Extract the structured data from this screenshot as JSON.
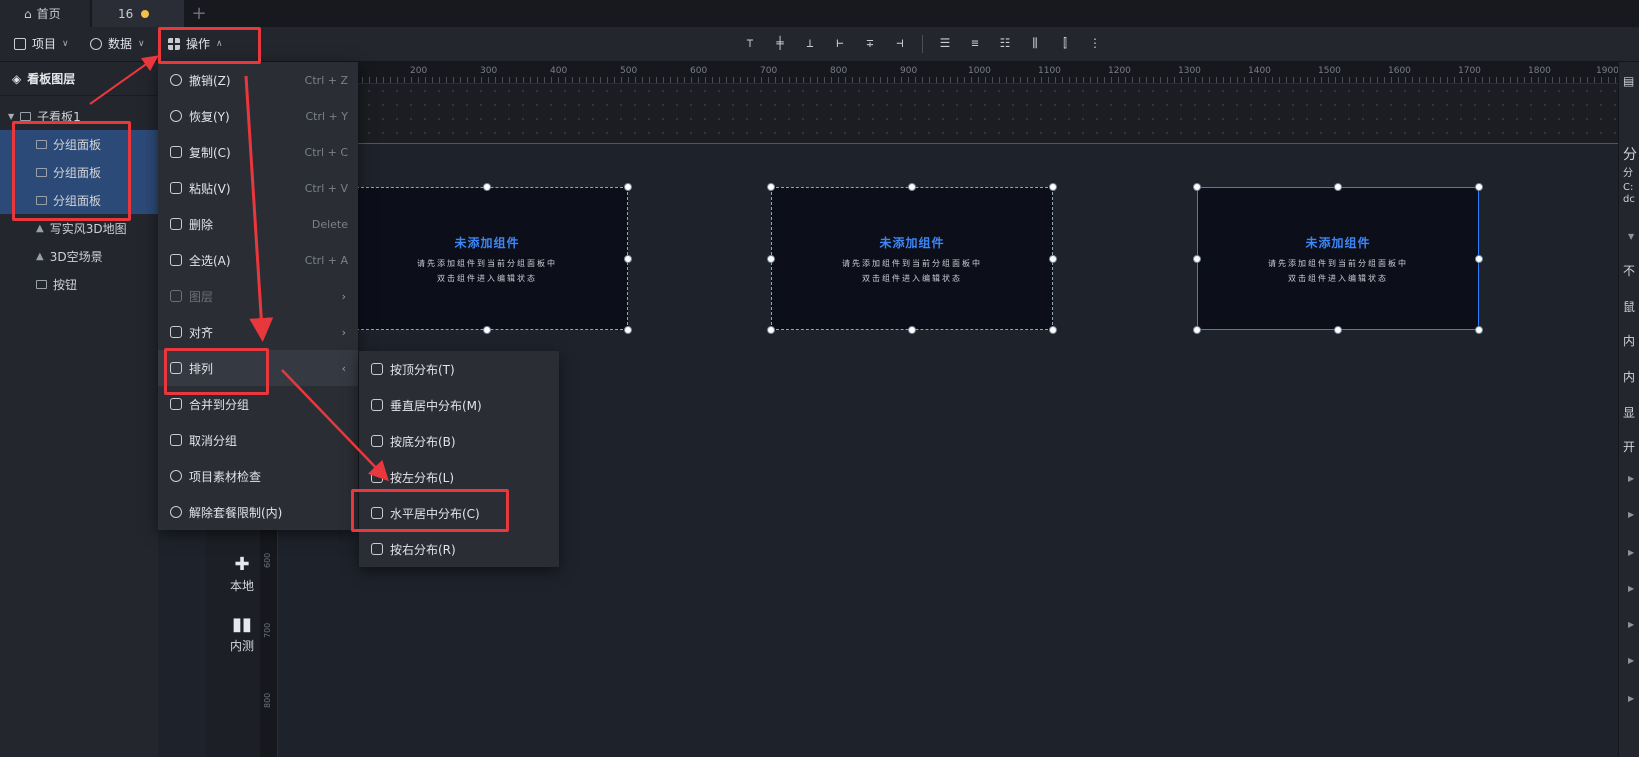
{
  "tabs": {
    "home": "首页",
    "doc": "16",
    "add": "+"
  },
  "toolbar": {
    "project": "项目",
    "data": "数据",
    "operate": "操作"
  },
  "align_tools": [
    "⊤",
    "╪",
    "⊥",
    "⊢",
    "∓",
    "⊣",
    "☰",
    "≡",
    "☷",
    "⫼",
    "⫿",
    "⋮"
  ],
  "layers": {
    "header": "看板图层",
    "root": "子看板1",
    "items": [
      "分组面板",
      "分组面板",
      "分组面板",
      "写实风3D地图",
      "3D空场景",
      "按钮"
    ]
  },
  "nav": {
    "local": "本地",
    "beta": "内测"
  },
  "ruler": {
    "h": [
      "200",
      "300",
      "400",
      "500",
      "600",
      "700",
      "800",
      "900",
      "1000",
      "1100",
      "1200",
      "1300",
      "1400",
      "1500",
      "1600",
      "1700",
      "1800",
      "1900"
    ],
    "v": [
      "600",
      "700",
      "800"
    ]
  },
  "panel": {
    "title": "未添加组件",
    "line1": "请先添加组件到当前分组面板中",
    "line2": "双击组件进入编辑状态"
  },
  "menu": [
    {
      "label": "撤销(Z)",
      "shortcut": "Ctrl + Z"
    },
    {
      "label": "恢复(Y)",
      "shortcut": "Ctrl + Y"
    },
    {
      "label": "复制(C)",
      "shortcut": "Ctrl + C"
    },
    {
      "label": "粘贴(V)",
      "shortcut": "Ctrl + V"
    },
    {
      "label": "删除",
      "shortcut": "Delete"
    },
    {
      "label": "全选(A)",
      "shortcut": "Ctrl + A"
    },
    {
      "label": "图层",
      "shortcut": "›"
    },
    {
      "label": "对齐",
      "shortcut": "›"
    },
    {
      "label": "排列",
      "shortcut": "‹"
    },
    {
      "label": "合并到分组",
      "shortcut": ""
    },
    {
      "label": "取消分组",
      "shortcut": ""
    },
    {
      "label": "项目素材检查",
      "shortcut": ""
    },
    {
      "label": "解除套餐限制(内)",
      "shortcut": ""
    }
  ],
  "submenu": [
    "按顶分布(T)",
    "垂直居中分布(M)",
    "按底分布(B)",
    "按左分布(L)",
    "水平居中分布(C)",
    "按右分布(R)"
  ],
  "right_panel": [
    "分",
    "分",
    "C:",
    "dc",
    "不",
    "鼠",
    "内",
    "内",
    "显",
    "开"
  ],
  "colors": {
    "accent": "#3d86f5",
    "highlight": "#e8383d",
    "selection": "#2c4a78"
  }
}
